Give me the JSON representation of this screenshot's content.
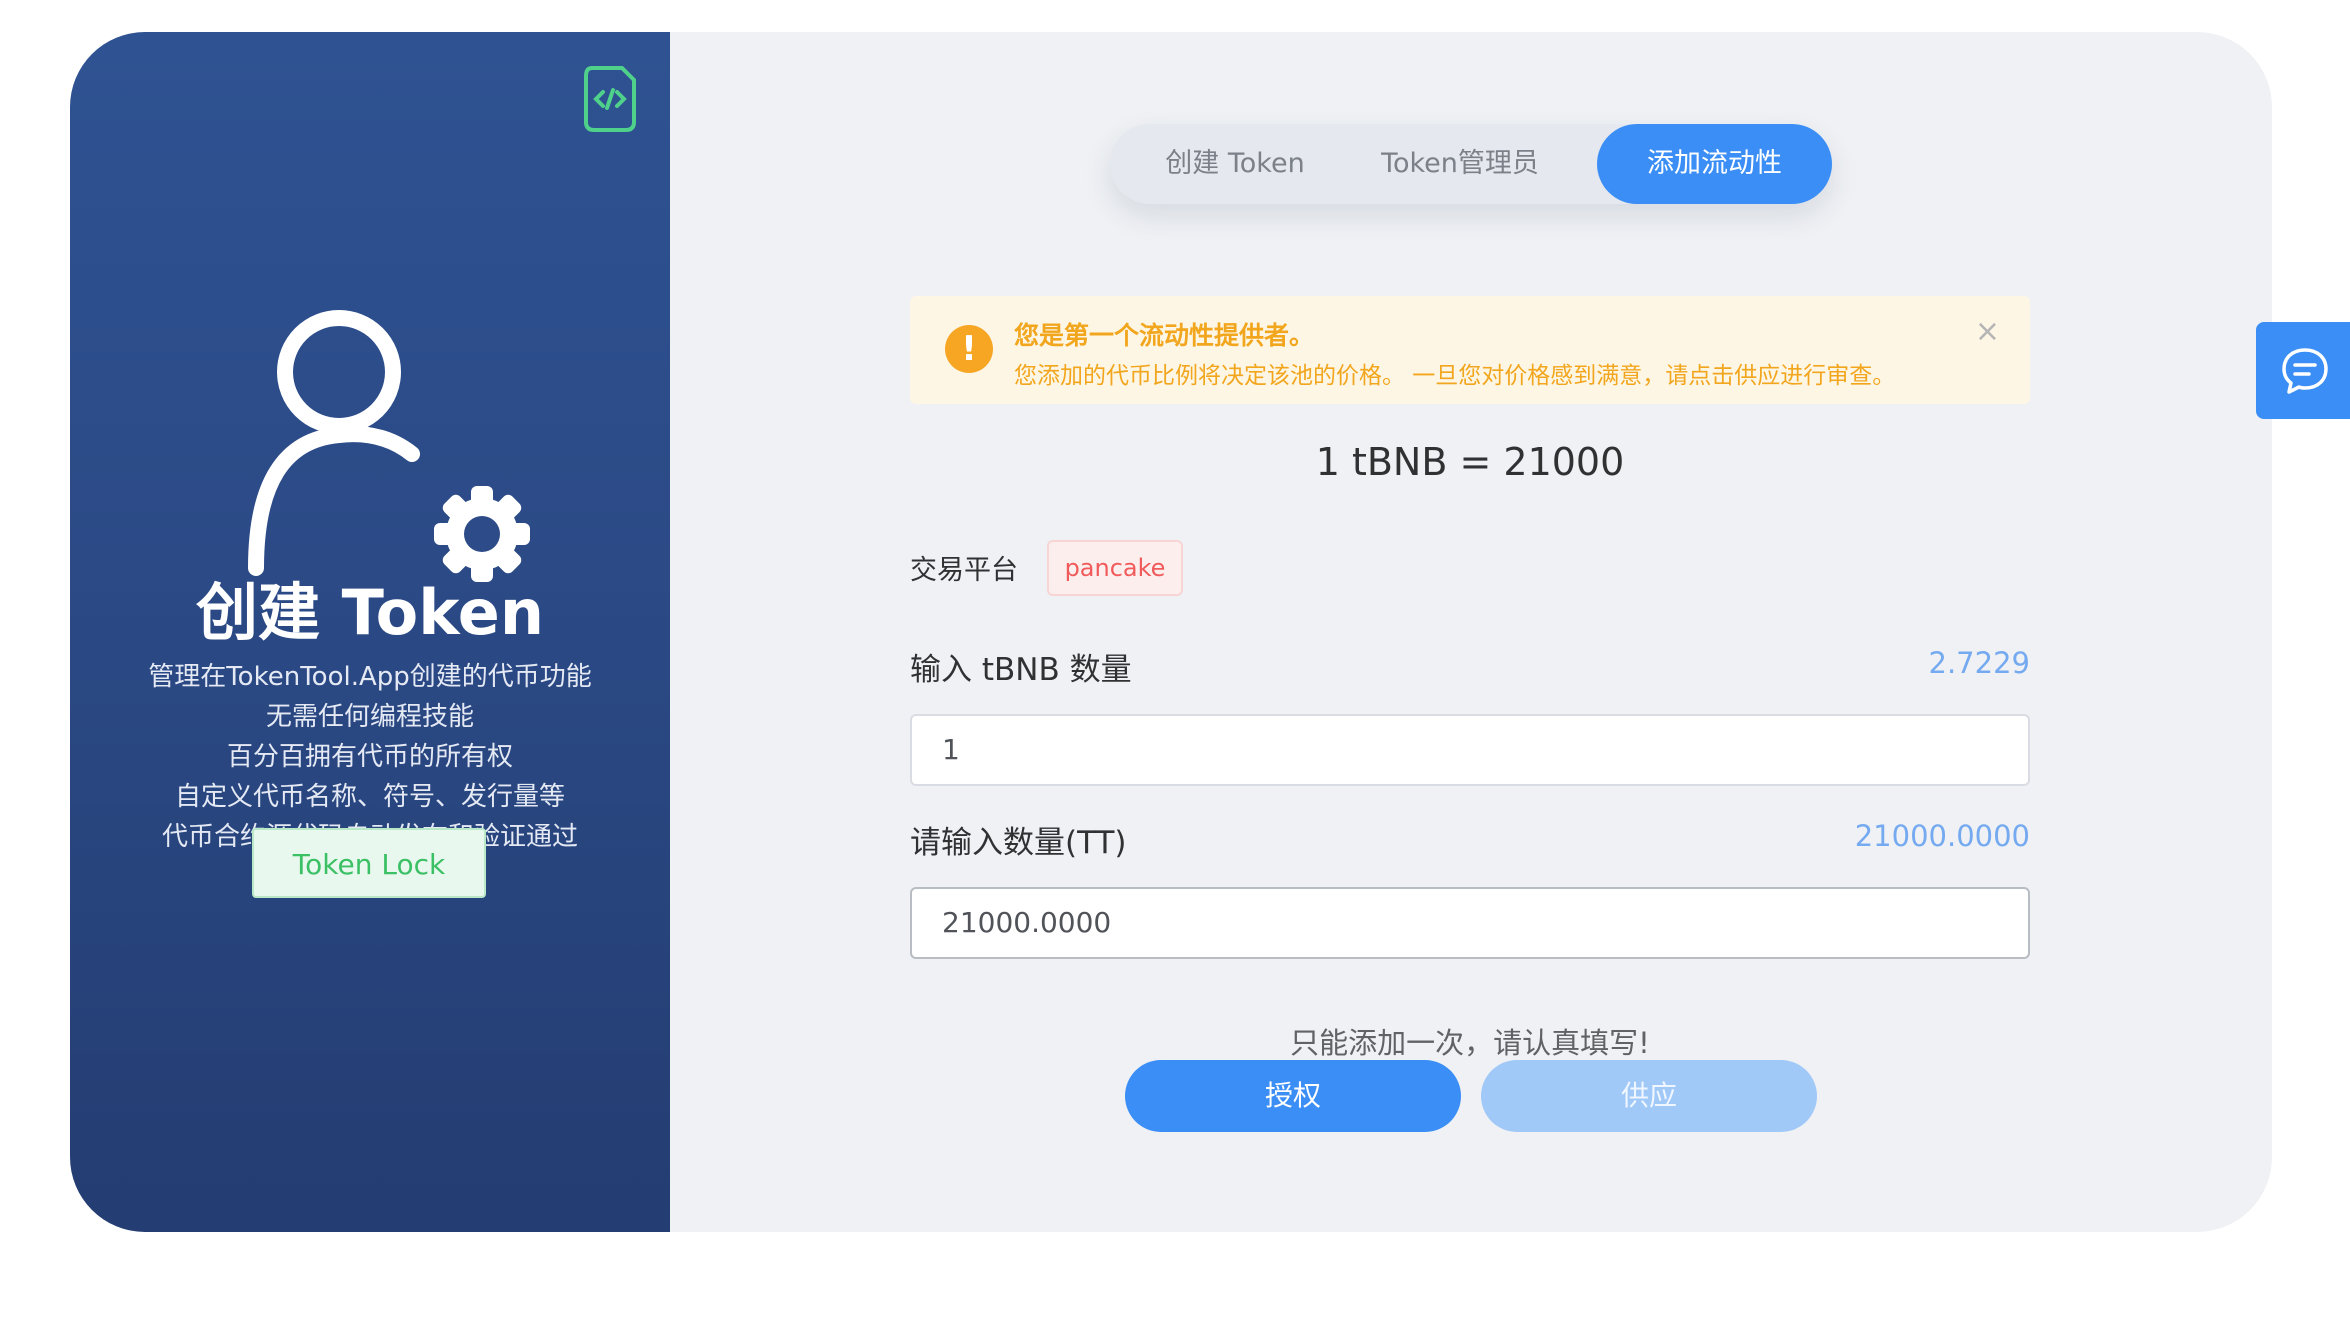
{
  "sidebar": {
    "title": "创建 Token",
    "lines": [
      "管理在TokenTool.App创建的代币功能",
      "无需任何编程技能",
      "百分百拥有代币的所有权",
      "自定义代币名称、符号、发行量等",
      "代币合约源代码自动发布和验证通过"
    ],
    "token_lock_label": "Token Lock",
    "icons": [
      "code-icon",
      "user-gear-icon"
    ]
  },
  "tabs": [
    {
      "label": "创建 Token",
      "active": false
    },
    {
      "label": "Token管理员",
      "active": false
    },
    {
      "label": "添加流动性",
      "active": true
    }
  ],
  "alert": {
    "icon": "exclamation",
    "title": "您是第一个流动性提供者。",
    "description": "您添加的代币比例将决定该池的价格。 一旦您对价格感到满意，请点击供应进行审查。",
    "close": "×"
  },
  "rate": "1 tBNB = 21000",
  "exchange": {
    "label": "交易平台",
    "tag": "pancake"
  },
  "field1": {
    "label": "输入 tBNB 数量",
    "balance": "2.7229",
    "value": "1"
  },
  "field2": {
    "label": "请输入数量(TT)",
    "balance": "21000.0000",
    "value": "21000.0000"
  },
  "notice": "只能添加一次，请认真填写!",
  "buttons": {
    "authorize": "授权",
    "supply": "供应"
  },
  "colors": {
    "primary": "#3a8ef6",
    "sidebar": "#2b4a86",
    "warning": "#f2a61e",
    "tag_red": "#f05a5a",
    "token_lock_green": "#3cc065"
  }
}
